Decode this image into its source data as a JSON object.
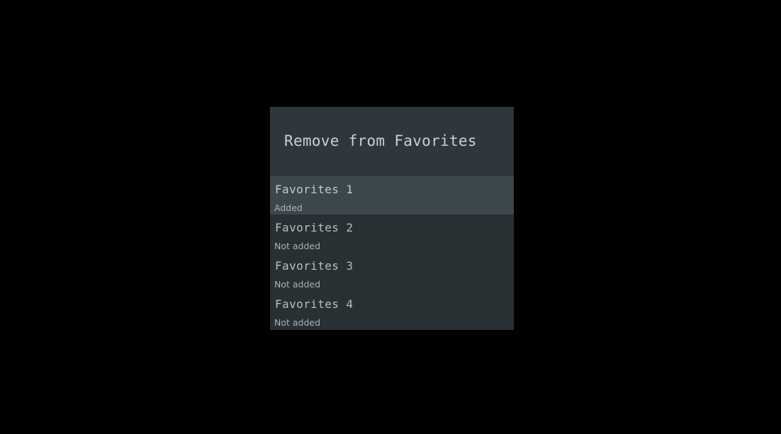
{
  "dialog": {
    "title": "Remove from Favorites",
    "items": [
      {
        "label": "Favorites 1",
        "status": "Added",
        "selected": true
      },
      {
        "label": "Favorites 2",
        "status": "Not added",
        "selected": false
      },
      {
        "label": "Favorites 3",
        "status": "Not added",
        "selected": false
      },
      {
        "label": "Favorites 4",
        "status": "Not added",
        "selected": false
      }
    ]
  },
  "colors": {
    "background": "#000000",
    "dialog_body": "#283034",
    "dialog_header": "#2e383c",
    "selected_row": "#3c474b",
    "text_primary": "#c9d0d3",
    "text_secondary": "#a9b1b4"
  }
}
